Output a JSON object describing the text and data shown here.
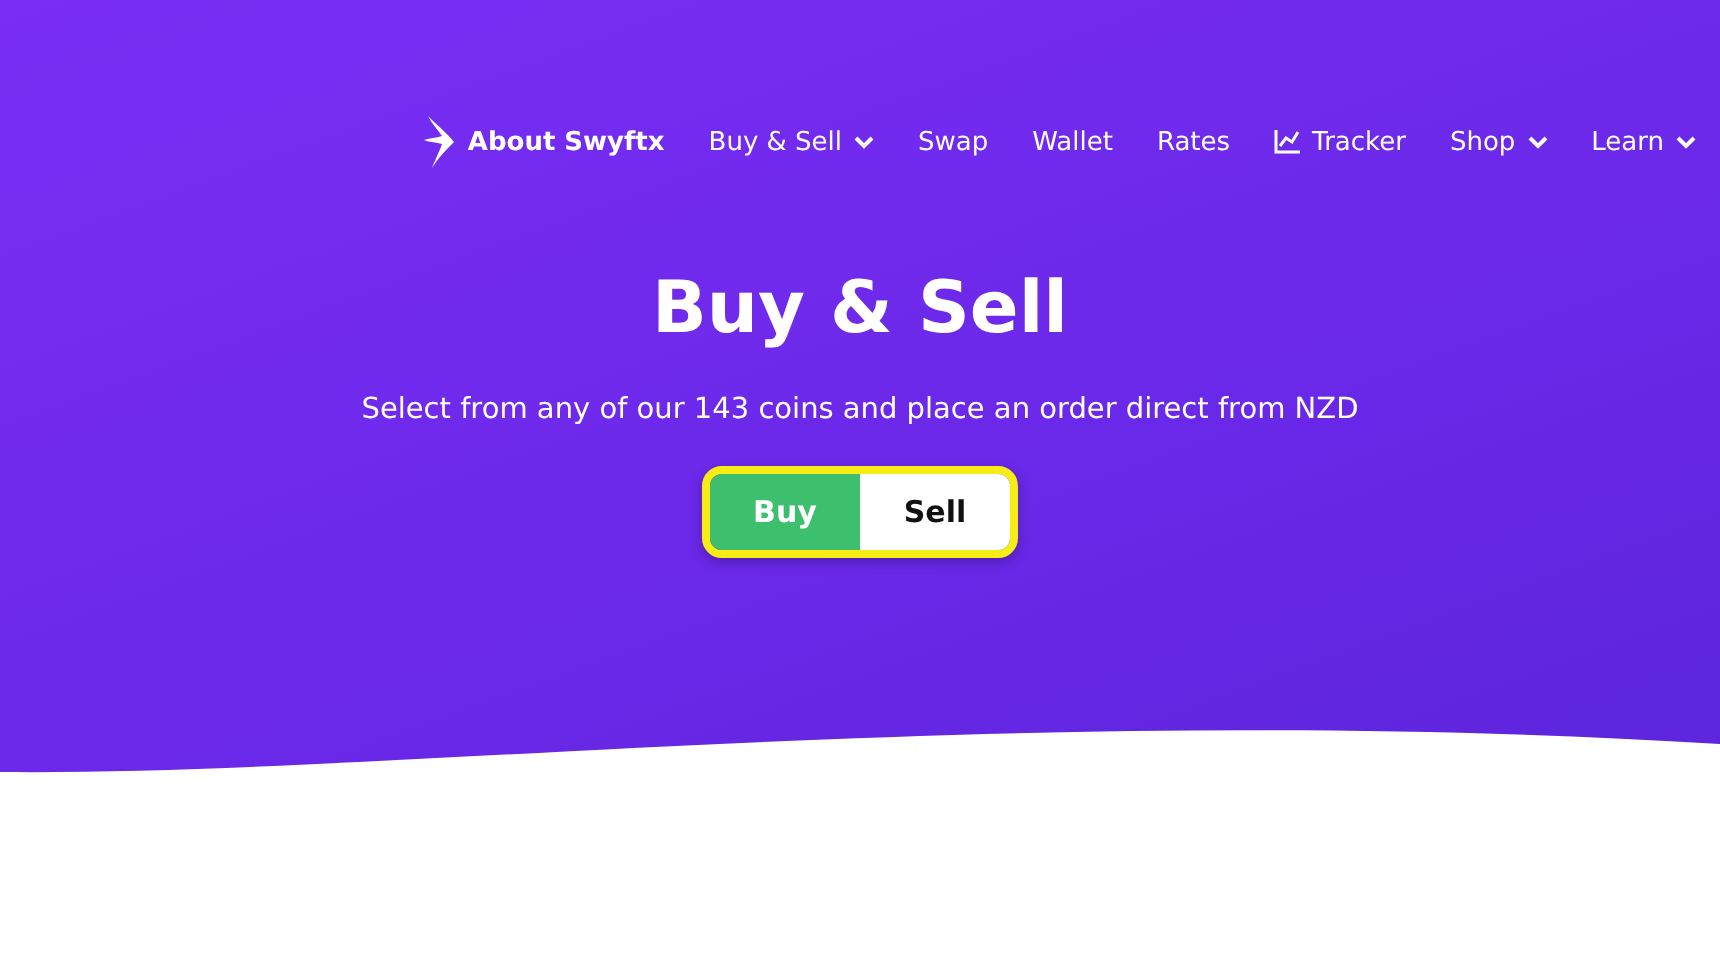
{
  "nav": [
    {
      "label": "About Swyftx",
      "kind": "brand"
    },
    {
      "label": "Buy & Sell",
      "kind": "dropdown"
    },
    {
      "label": "Swap",
      "kind": "plain"
    },
    {
      "label": "Wallet",
      "kind": "plain"
    },
    {
      "label": "Rates",
      "kind": "plain"
    },
    {
      "label": "Tracker",
      "kind": "chart"
    },
    {
      "label": "Shop",
      "kind": "dropdown"
    },
    {
      "label": "Learn",
      "kind": "dropdown"
    }
  ],
  "hero": {
    "title": "Buy & Sell",
    "subtitle": "Select from any of our 143 coins and place an order direct from NZD"
  },
  "toggle": [
    {
      "label": "Buy",
      "selected": true
    },
    {
      "label": "Sell",
      "selected": false
    }
  ]
}
